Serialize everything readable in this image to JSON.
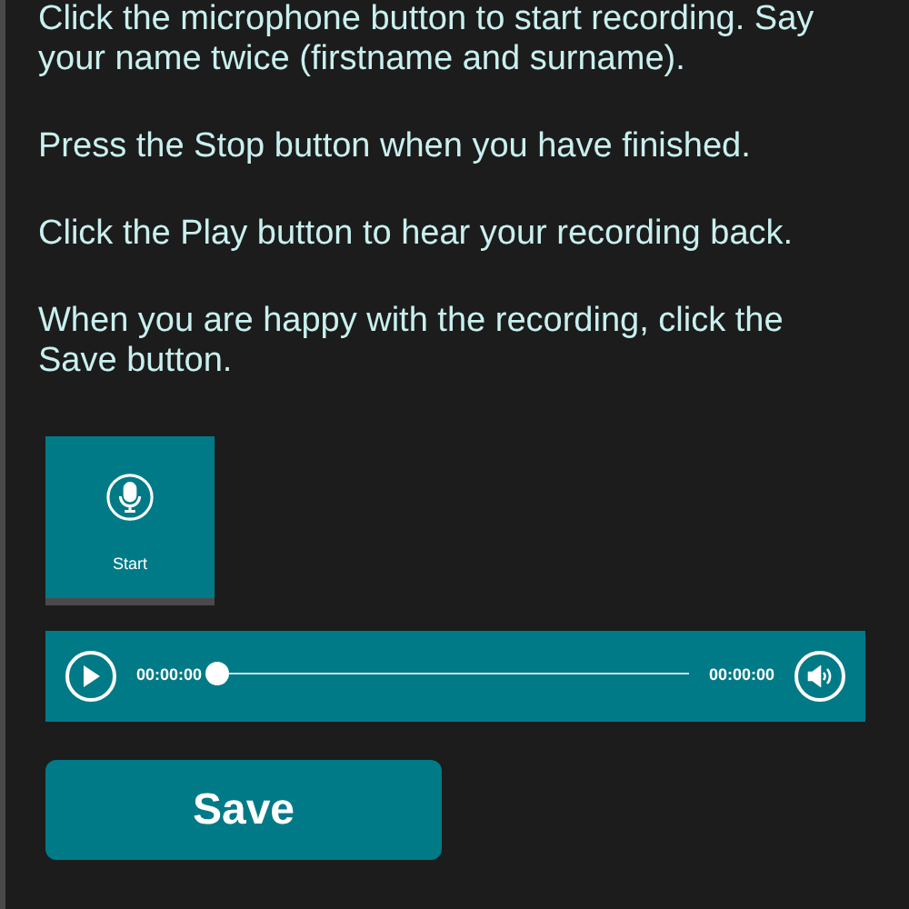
{
  "instructions": [
    "Click the microphone button to start recording. Say your name twice (firstname and surname).",
    "Press the Stop button when you have finished.",
    "Click the Play button to hear your recording back.",
    "When you are happy with the recording, click the Save button."
  ],
  "record_button": {
    "label": "Start"
  },
  "player": {
    "elapsed": "00:00:00",
    "duration": "00:00:00",
    "level": 0
  },
  "save_button": {
    "label": "Save"
  }
}
